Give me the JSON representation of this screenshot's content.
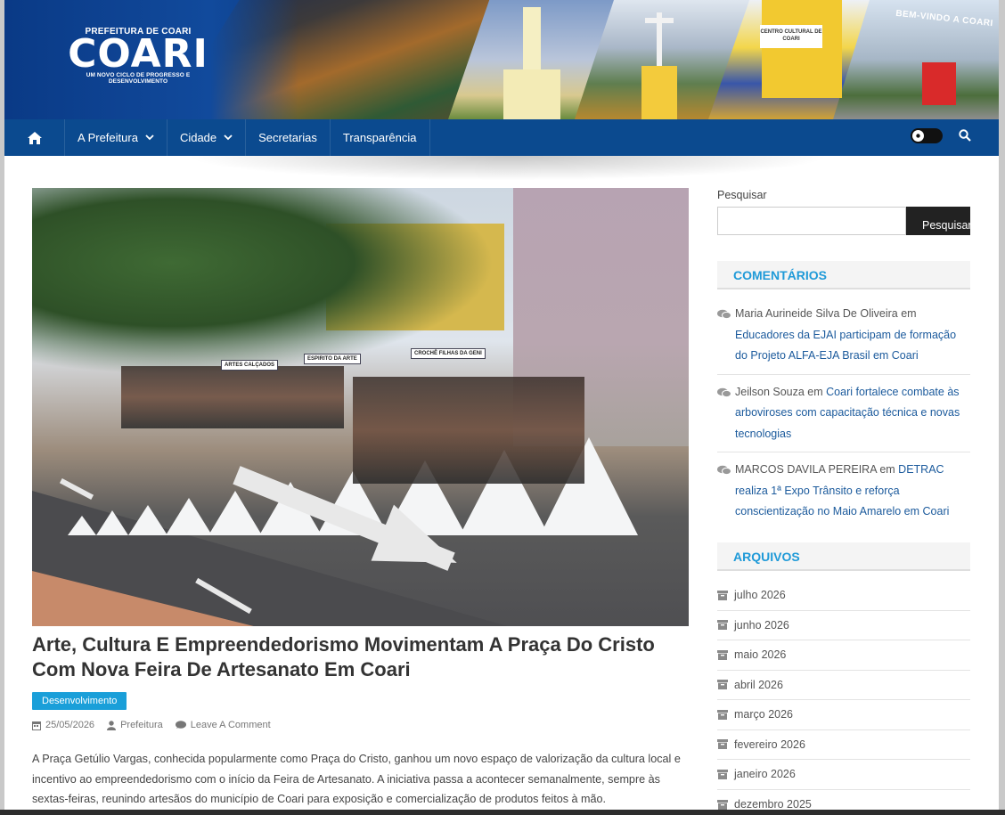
{
  "header": {
    "logo_prefix": "PREFEITURA DE COARI",
    "logo_name": "COARI",
    "logo_slogan": "UM NOVO CICLO DE PROGRESSO E DESENVOLVIMENTO",
    "banner_sign_building": "CENTRO CULTURAL DE COARI",
    "banner_arch_text": "BEM-VINDO A COARI"
  },
  "nav": {
    "home_icon": "home-icon",
    "items": [
      {
        "label": "A Prefeitura",
        "has_dropdown": true
      },
      {
        "label": "Cidade",
        "has_dropdown": true
      },
      {
        "label": "Secretarias",
        "has_dropdown": false
      },
      {
        "label": "Transparência",
        "has_dropdown": false
      }
    ],
    "toggle_icon": "dark-mode-toggle",
    "search_icon": "search-icon"
  },
  "post": {
    "image_signs": [
      "ESPIRITO DA ARTE",
      "CROCHÊ FILHAS DA GENI",
      "ARTES CALÇADOS"
    ],
    "title": "Arte, Cultura E Empreendedorismo Movimentam A Praça Do Cristo Com Nova Feira De Artesanato Em Coari",
    "category": "Desenvolvimento",
    "date": "25/05/2026",
    "author": "Prefeitura",
    "comment_link": "Leave A Comment",
    "excerpt": "A Praça Getúlio Vargas, conhecida popularmente como Praça do Cristo, ganhou um novo espaço de valorização da cultura local e incentivo ao empreendedorismo com o início da Feira de Artesanato. A iniciativa passa a acontecer semanalmente, sempre às sextas-feiras, reunindo artesãos do município de Coari para exposição e comercialização de produtos feitos à mão."
  },
  "sidebar": {
    "search_label": "Pesquisar",
    "search_placeholder": "",
    "search_button": "Pesquisar",
    "comments_title": "COMENTÁRIOS",
    "comments": [
      {
        "author": "Maria Aurineide Silva De Oliveira",
        "connector": " em ",
        "link": "Educadores da EJAI participam de formação do Projeto ALFA-EJA Brasil em Coari"
      },
      {
        "author": "Jeilson Souza",
        "connector": " em ",
        "link": "Coari fortalece combate às arboviroses com capacitação técnica e novas tecnologias"
      },
      {
        "author": "MARCOS DAVILA PEREIRA",
        "connector": " em ",
        "link": "DETRAC realiza 1ª Expo Trânsito e reforça conscientização no Maio Amarelo em Coari"
      }
    ],
    "archives_title": "ARQUIVOS",
    "archives": [
      "julho 2026",
      "junho 2026",
      "maio 2026",
      "abril 2026",
      "março 2026",
      "fevereiro 2026",
      "janeiro 2026",
      "dezembro 2025"
    ]
  },
  "colors": {
    "nav_bg": "#0b4a8f",
    "accent": "#1f9ad8",
    "link": "#1b5a9c",
    "category_bg": "#1a9fd9"
  }
}
